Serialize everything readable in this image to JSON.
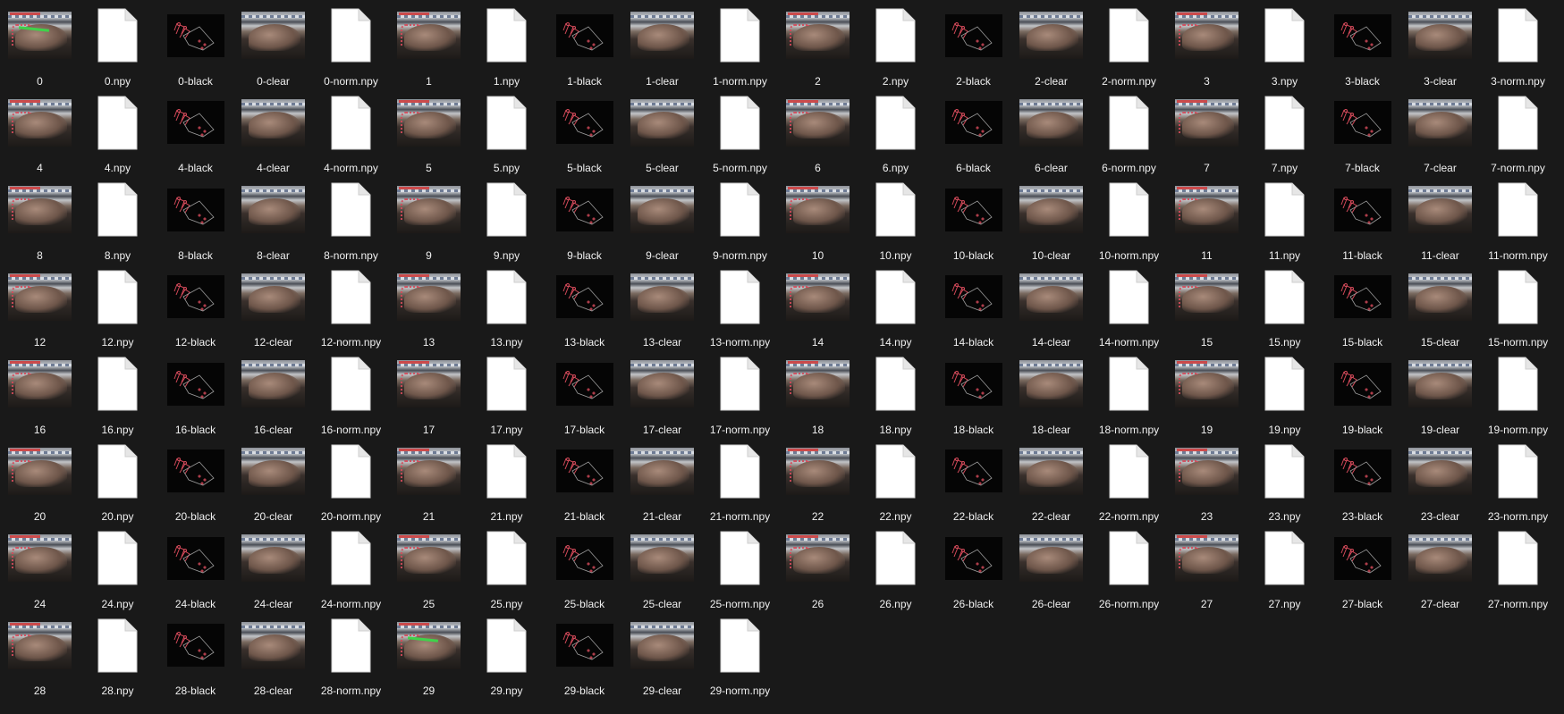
{
  "window_title": "",
  "colors": {
    "background": "#191919",
    "label": "#f0f0f0",
    "file_icon": "#ffffff",
    "accent_red": "#d44a5a",
    "accent_green": "#3fd24a"
  },
  "item_types": {
    "photo": "image-thumbnail",
    "npy": "blank-file-icon",
    "black": "black-image-thumbnail",
    "clear": "image-thumbnail",
    "norm": "blank-file-icon"
  },
  "files": [
    {
      "name": "0",
      "kind": "photo",
      "green": true
    },
    {
      "name": "0.npy",
      "kind": "file"
    },
    {
      "name": "0-black",
      "kind": "black"
    },
    {
      "name": "0-clear",
      "kind": "clear"
    },
    {
      "name": "0-norm.npy",
      "kind": "file"
    },
    {
      "name": "1",
      "kind": "photo"
    },
    {
      "name": "1.npy",
      "kind": "file"
    },
    {
      "name": "1-black",
      "kind": "black"
    },
    {
      "name": "1-clear",
      "kind": "clear"
    },
    {
      "name": "1-norm.npy",
      "kind": "file"
    },
    {
      "name": "2",
      "kind": "photo"
    },
    {
      "name": "2.npy",
      "kind": "file"
    },
    {
      "name": "2-black",
      "kind": "black"
    },
    {
      "name": "2-clear",
      "kind": "clear"
    },
    {
      "name": "2-norm.npy",
      "kind": "file"
    },
    {
      "name": "3",
      "kind": "photo"
    },
    {
      "name": "3.npy",
      "kind": "file"
    },
    {
      "name": "3-black",
      "kind": "black"
    },
    {
      "name": "3-clear",
      "kind": "clear"
    },
    {
      "name": "3-norm.npy",
      "kind": "file"
    },
    {
      "name": "4",
      "kind": "photo"
    },
    {
      "name": "4.npy",
      "kind": "file"
    },
    {
      "name": "4-black",
      "kind": "black"
    },
    {
      "name": "4-clear",
      "kind": "clear"
    },
    {
      "name": "4-norm.npy",
      "kind": "file"
    },
    {
      "name": "5",
      "kind": "photo"
    },
    {
      "name": "5.npy",
      "kind": "file"
    },
    {
      "name": "5-black",
      "kind": "black"
    },
    {
      "name": "5-clear",
      "kind": "clear"
    },
    {
      "name": "5-norm.npy",
      "kind": "file"
    },
    {
      "name": "6",
      "kind": "photo"
    },
    {
      "name": "6.npy",
      "kind": "file"
    },
    {
      "name": "6-black",
      "kind": "black"
    },
    {
      "name": "6-clear",
      "kind": "clear"
    },
    {
      "name": "6-norm.npy",
      "kind": "file"
    },
    {
      "name": "7",
      "kind": "photo"
    },
    {
      "name": "7.npy",
      "kind": "file"
    },
    {
      "name": "7-black",
      "kind": "black"
    },
    {
      "name": "7-clear",
      "kind": "clear"
    },
    {
      "name": "7-norm.npy",
      "kind": "file"
    },
    {
      "name": "8",
      "kind": "photo"
    },
    {
      "name": "8.npy",
      "kind": "file"
    },
    {
      "name": "8-black",
      "kind": "black"
    },
    {
      "name": "8-clear",
      "kind": "clear"
    },
    {
      "name": "8-norm.npy",
      "kind": "file"
    },
    {
      "name": "9",
      "kind": "photo"
    },
    {
      "name": "9.npy",
      "kind": "file"
    },
    {
      "name": "9-black",
      "kind": "black"
    },
    {
      "name": "9-clear",
      "kind": "clear"
    },
    {
      "name": "9-norm.npy",
      "kind": "file"
    },
    {
      "name": "10",
      "kind": "photo"
    },
    {
      "name": "10.npy",
      "kind": "file"
    },
    {
      "name": "10-black",
      "kind": "black"
    },
    {
      "name": "10-clear",
      "kind": "clear"
    },
    {
      "name": "10-norm.npy",
      "kind": "file"
    },
    {
      "name": "11",
      "kind": "photo"
    },
    {
      "name": "11.npy",
      "kind": "file"
    },
    {
      "name": "11-black",
      "kind": "black"
    },
    {
      "name": "11-clear",
      "kind": "clear"
    },
    {
      "name": "11-norm.npy",
      "kind": "file"
    },
    {
      "name": "12",
      "kind": "photo"
    },
    {
      "name": "12.npy",
      "kind": "file"
    },
    {
      "name": "12-black",
      "kind": "black"
    },
    {
      "name": "12-clear",
      "kind": "clear"
    },
    {
      "name": "12-norm.npy",
      "kind": "file"
    },
    {
      "name": "13",
      "kind": "photo"
    },
    {
      "name": "13.npy",
      "kind": "file"
    },
    {
      "name": "13-black",
      "kind": "black"
    },
    {
      "name": "13-clear",
      "kind": "clear"
    },
    {
      "name": "13-norm.npy",
      "kind": "file"
    },
    {
      "name": "14",
      "kind": "photo"
    },
    {
      "name": "14.npy",
      "kind": "file"
    },
    {
      "name": "14-black",
      "kind": "black"
    },
    {
      "name": "14-clear",
      "kind": "clear"
    },
    {
      "name": "14-norm.npy",
      "kind": "file"
    },
    {
      "name": "15",
      "kind": "photo"
    },
    {
      "name": "15.npy",
      "kind": "file"
    },
    {
      "name": "15-black",
      "kind": "black"
    },
    {
      "name": "15-clear",
      "kind": "clear"
    },
    {
      "name": "15-norm.npy",
      "kind": "file"
    },
    {
      "name": "16",
      "kind": "photo"
    },
    {
      "name": "16.npy",
      "kind": "file"
    },
    {
      "name": "16-black",
      "kind": "black"
    },
    {
      "name": "16-clear",
      "kind": "clear"
    },
    {
      "name": "16-norm.npy",
      "kind": "file"
    },
    {
      "name": "17",
      "kind": "photo"
    },
    {
      "name": "17.npy",
      "kind": "file"
    },
    {
      "name": "17-black",
      "kind": "black"
    },
    {
      "name": "17-clear",
      "kind": "clear"
    },
    {
      "name": "17-norm.npy",
      "kind": "file"
    },
    {
      "name": "18",
      "kind": "photo"
    },
    {
      "name": "18.npy",
      "kind": "file"
    },
    {
      "name": "18-black",
      "kind": "black"
    },
    {
      "name": "18-clear",
      "kind": "clear"
    },
    {
      "name": "18-norm.npy",
      "kind": "file"
    },
    {
      "name": "19",
      "kind": "photo"
    },
    {
      "name": "19.npy",
      "kind": "file"
    },
    {
      "name": "19-black",
      "kind": "black"
    },
    {
      "name": "19-clear",
      "kind": "clear"
    },
    {
      "name": "19-norm.npy",
      "kind": "file"
    },
    {
      "name": "20",
      "kind": "photo"
    },
    {
      "name": "20.npy",
      "kind": "file"
    },
    {
      "name": "20-black",
      "kind": "black"
    },
    {
      "name": "20-clear",
      "kind": "clear"
    },
    {
      "name": "20-norm.npy",
      "kind": "file"
    },
    {
      "name": "21",
      "kind": "photo"
    },
    {
      "name": "21.npy",
      "kind": "file"
    },
    {
      "name": "21-black",
      "kind": "black"
    },
    {
      "name": "21-clear",
      "kind": "clear"
    },
    {
      "name": "21-norm.npy",
      "kind": "file"
    },
    {
      "name": "22",
      "kind": "photo"
    },
    {
      "name": "22.npy",
      "kind": "file"
    },
    {
      "name": "22-black",
      "kind": "black"
    },
    {
      "name": "22-clear",
      "kind": "clear"
    },
    {
      "name": "22-norm.npy",
      "kind": "file"
    },
    {
      "name": "23",
      "kind": "photo"
    },
    {
      "name": "23.npy",
      "kind": "file"
    },
    {
      "name": "23-black",
      "kind": "black"
    },
    {
      "name": "23-clear",
      "kind": "clear"
    },
    {
      "name": "23-norm.npy",
      "kind": "file"
    },
    {
      "name": "24",
      "kind": "photo"
    },
    {
      "name": "24.npy",
      "kind": "file"
    },
    {
      "name": "24-black",
      "kind": "black"
    },
    {
      "name": "24-clear",
      "kind": "clear"
    },
    {
      "name": "24-norm.npy",
      "kind": "file"
    },
    {
      "name": "25",
      "kind": "photo"
    },
    {
      "name": "25.npy",
      "kind": "file"
    },
    {
      "name": "25-black",
      "kind": "black"
    },
    {
      "name": "25-clear",
      "kind": "clear"
    },
    {
      "name": "25-norm.npy",
      "kind": "file"
    },
    {
      "name": "26",
      "kind": "photo"
    },
    {
      "name": "26.npy",
      "kind": "file"
    },
    {
      "name": "26-black",
      "kind": "black"
    },
    {
      "name": "26-clear",
      "kind": "clear"
    },
    {
      "name": "26-norm.npy",
      "kind": "file"
    },
    {
      "name": "27",
      "kind": "photo"
    },
    {
      "name": "27.npy",
      "kind": "file"
    },
    {
      "name": "27-black",
      "kind": "black"
    },
    {
      "name": "27-clear",
      "kind": "clear"
    },
    {
      "name": "27-norm.npy",
      "kind": "file"
    },
    {
      "name": "28",
      "kind": "photo"
    },
    {
      "name": "28.npy",
      "kind": "file"
    },
    {
      "name": "28-black",
      "kind": "black"
    },
    {
      "name": "28-clear",
      "kind": "clear"
    },
    {
      "name": "28-norm.npy",
      "kind": "file"
    },
    {
      "name": "29",
      "kind": "photo",
      "green": true
    },
    {
      "name": "29.npy",
      "kind": "file"
    },
    {
      "name": "29-black",
      "kind": "black"
    },
    {
      "name": "29-clear",
      "kind": "clear"
    },
    {
      "name": "29-norm.npy",
      "kind": "file"
    }
  ]
}
